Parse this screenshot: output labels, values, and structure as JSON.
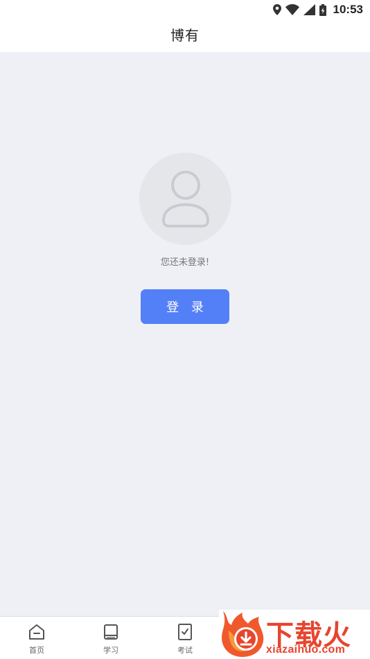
{
  "status_bar": {
    "time": "10:53",
    "icons": [
      "location-icon",
      "wifi-icon",
      "signal-icon",
      "battery-icon"
    ]
  },
  "header": {
    "title": "博有"
  },
  "profile": {
    "avatar_icon": "user-placeholder-icon",
    "not_logged_in_text": "您还未登录!",
    "login_label": "登 录",
    "accent_color": "#5480f7"
  },
  "tabs": [
    {
      "label": "首页",
      "icon": "home-icon"
    },
    {
      "label": "学习",
      "icon": "book-icon"
    },
    {
      "label": "考试",
      "icon": "exam-icon"
    }
  ],
  "watermark": {
    "title": "下载火",
    "url": "xiazaihuo.com",
    "color": "#e8442e"
  }
}
